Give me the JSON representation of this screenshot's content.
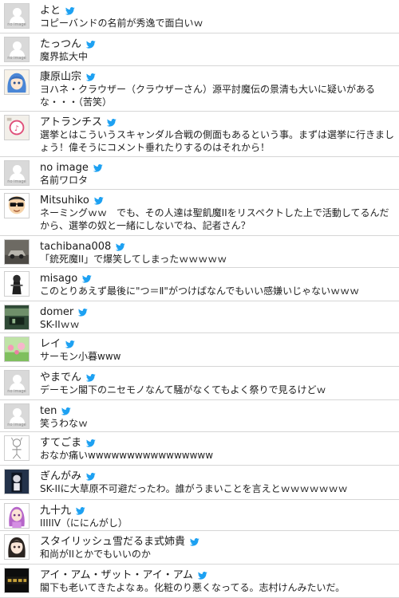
{
  "feed": {
    "posts": [
      {
        "user": "よと",
        "text": "コピーバンドの名前が秀逸で面白いｗ",
        "avatar": "no-image",
        "avatar_caption": "no image"
      },
      {
        "user": "たっつん",
        "text": "魔界拡大中",
        "avatar": "no-image",
        "avatar_caption": "no image"
      },
      {
        "user": "康原山宗",
        "text": "ヨハネ・クラウザー（クラウザーさん）源平討魔伝の景清も大いに疑いがあるな・・・（苦笑）",
        "avatar": "anime-blue-hair",
        "avatar_caption": ""
      },
      {
        "user": "アトランチス",
        "text": "選挙とはこういうスキャンダル合戦の側面もあるという事。まずは選挙に行きましょう！偉そうにコメント垂れたりするのはそれから！",
        "avatar": "pink-sign",
        "avatar_caption": ""
      },
      {
        "user": "no image",
        "text": "名前ワロタ",
        "avatar": "no-image",
        "avatar_caption": "no image"
      },
      {
        "user": "Mitsuhiko",
        "text": "ネーミングｗｗ　でも、その人達は聖飢魔IIをリスペクトした上で活動してるんだから、選挙の奴と一緒にしないでね、記者さん？",
        "avatar": "sunglasses-face",
        "avatar_caption": ""
      },
      {
        "user": "tachibana008",
        "text": "「銃死魔II」で爆笑してしまったｗｗｗｗｗ",
        "avatar": "car-photo",
        "avatar_caption": ""
      },
      {
        "user": "misago",
        "text": "このとりあえず最後に\"つ＝Ⅱ\"がつけばなんでもいい感嫌いじゃないｗｗｗ",
        "avatar": "dark-figure",
        "avatar_caption": ""
      },
      {
        "user": "domer",
        "text": "SK-IIｗｗ",
        "avatar": "green-photo",
        "avatar_caption": ""
      },
      {
        "user": "レイ",
        "text": "サーモン小暮www",
        "avatar": "pink-flowers",
        "avatar_caption": ""
      },
      {
        "user": "やまでん",
        "text": "デーモン閣下のニセモノなんて騒がなくてもよく祭りで見るけどｗ",
        "avatar": "no-image",
        "avatar_caption": "no image"
      },
      {
        "user": "ten",
        "text": "笑うわなｗ",
        "avatar": "no-image",
        "avatar_caption": "no image"
      },
      {
        "user": "すてごま",
        "text": "おなか痛いwwwwwwwwwwwwwwww",
        "avatar": "sketch-character",
        "avatar_caption": ""
      },
      {
        "user": "ぎんがみ",
        "text": "SK-IIに大草原不可避だったわ。誰がうまいことを言えとｗｗｗｗｗｗｗ",
        "avatar": "dark-portrait",
        "avatar_caption": ""
      },
      {
        "user": "九十九",
        "text": "IIIIIV（ににんがし）",
        "avatar": "purple-character",
        "avatar_caption": ""
      },
      {
        "user": "スタイリッシュ雪だるま式姉貴",
        "text": "和尚がIIとかでもいいのか",
        "avatar": "anime-girl",
        "avatar_caption": ""
      },
      {
        "user": "アイ・アム・ザット・アイ・アム",
        "text": "閣下も老いてきたよなぁ。化粧のり悪くなってる。志村けんみたいだ。",
        "avatar": "dark-banner",
        "avatar_caption": ""
      }
    ],
    "bird_color": "#1da1f2"
  }
}
